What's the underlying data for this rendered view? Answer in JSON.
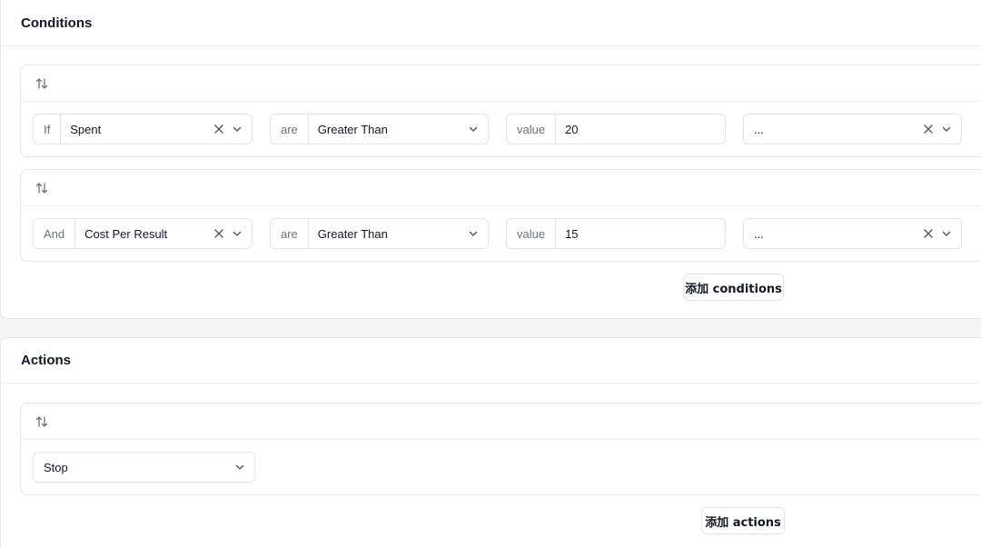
{
  "conditions": {
    "title": "Conditions",
    "rules": [
      {
        "prefix": "If",
        "field": "Spent",
        "operator_prefix": "are",
        "operator": "Greater Than",
        "value_prefix": "value",
        "value": "20",
        "extra": "..."
      },
      {
        "prefix": "And",
        "field": "Cost Per Result",
        "operator_prefix": "are",
        "operator": "Greater Than",
        "value_prefix": "value",
        "value": "15",
        "extra": "..."
      }
    ],
    "add_label": "添加 conditions"
  },
  "actions": {
    "title": "Actions",
    "items": [
      {
        "value": "Stop"
      }
    ],
    "add_label": "添加 actions"
  },
  "icons": {
    "sort": "sort-arrows-icon",
    "clear": "close-icon",
    "dropdown": "chevron-down-icon"
  },
  "colors": {
    "page_bg": "#f4f4f5",
    "card_bg": "#ffffff",
    "border": "#e4e4e7",
    "muted_text": "#6b7280",
    "text": "#111827"
  }
}
